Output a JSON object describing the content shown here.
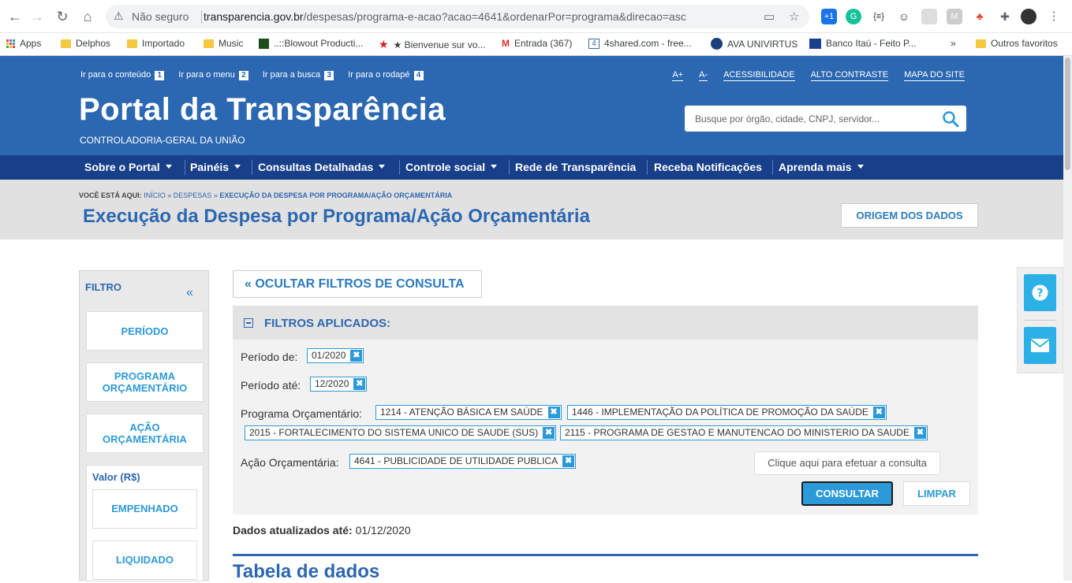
{
  "browser": {
    "insecure_label": "Não seguro",
    "url_host": "transparencia.gov.br",
    "url_path": "/despesas/programa-e-acao?acao=4641&ordenarPor=programa&direcao=asc",
    "ext_badge": "+1",
    "bookmarks": [
      "Apps",
      "Delphos",
      "Importado",
      "Music",
      "..::Blowout Producti...",
      "★ Bienvenue sur vo...",
      "Entrada (367)",
      "4shared.com - free...",
      "AVA UNIVIRTUS",
      "Banco Itaú - Feito P...",
      "»",
      "Outros favoritos"
    ]
  },
  "header": {
    "skip_links": [
      {
        "label": "Ir para o conteúdo",
        "num": "1"
      },
      {
        "label": "Ir para o menu",
        "num": "2"
      },
      {
        "label": "Ir para a busca",
        "num": "3"
      },
      {
        "label": "Ir para o rodapé",
        "num": "4"
      }
    ],
    "access_links": [
      "A+",
      "A-",
      "ACESSIBILIDADE",
      "ALTO CONTRASTE",
      "MAPA DO SITE"
    ],
    "title": "Portal da Transparência",
    "subtitle": "CONTROLADORIA-GERAL DA UNIÃO",
    "search_placeholder": "Busque por órgão, cidade, CNPJ, servidor..."
  },
  "nav": {
    "items": [
      "Sobre o Portal",
      "Painéis",
      "Consultas Detalhadas",
      "Controle social",
      "Rede de Transparência",
      "Receba Notificações",
      "Aprenda mais"
    ]
  },
  "breadcrumb": {
    "prefix": "VOCÊ ESTÁ AQUI:",
    "home": "INÍCIO",
    "sep": "»",
    "section": "DESPESAS",
    "current": "EXECUÇÃO DA DESPESA POR PROGRAMA/AÇÃO ORÇAMENTÁRIA"
  },
  "page": {
    "title": "Execução da Despesa por Programa/Ação Orçamentária",
    "origin_button": "ORIGEM DOS DADOS"
  },
  "sidebar": {
    "title": "FILTRO",
    "collapse_icon": "«",
    "buttons": [
      "PERÍODO",
      "PROGRAMA ORÇAMENTÁRIO",
      "AÇÃO ORÇAMENTÁRIA"
    ],
    "valor_label": "Valor (R$)",
    "valor_buttons": [
      "EMPENHADO",
      "LIQUIDADO"
    ]
  },
  "filters": {
    "hide_button": "« OCULTAR FILTROS DE CONSULTA",
    "applied_title": "FILTROS APLICADOS:",
    "periodo_de_label": "Período de:",
    "periodo_de": "01/2020",
    "periodo_ate_label": "Período até:",
    "periodo_ate": "12/2020",
    "programa_label": "Programa Orçamentário:",
    "programas": [
      "1214 - ATENÇÃO BÁSICA EM SAÚDE",
      "1446 - IMPLEMENTAÇÃO DA POLÍTICA DE PROMOÇÃO DA SAÚDE",
      "2015 - FORTALECIMENTO DO SISTEMA UNICO DE SAUDE (SUS)",
      "2115 - PROGRAMA DE GESTAO E MANUTENCAO DO MINISTERIO DA SAUDE"
    ],
    "acao_label": "Ação Orçamentária:",
    "acao": "4641 - PUBLICIDADE DE UTILIDADE PUBLICA",
    "remove_glyph": "✖",
    "hint": "Clique aqui para efetuar a consulta",
    "consultar": "CONSULTAR",
    "limpar": "LIMPAR"
  },
  "data_info": {
    "updated_label": "Dados atualizados até:",
    "updated_value": "01/12/2020",
    "table_title": "Tabela de dados"
  },
  "colors": {
    "header_blue": "#2c67b1",
    "nav_blue": "#183f8a",
    "accent": "#2c9ad9"
  }
}
